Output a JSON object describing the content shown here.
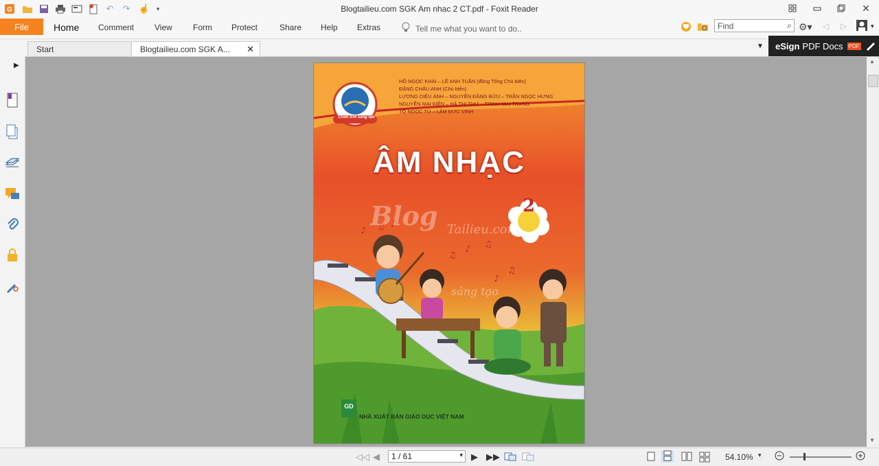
{
  "window": {
    "title": "Blogtailieu.com SGK Am nhac 2 CT.pdf - Foxit Reader"
  },
  "menu": {
    "file": "File",
    "items": [
      "Home",
      "Comment",
      "View",
      "Form",
      "Protect",
      "Share",
      "Help",
      "Extras"
    ],
    "tell_me": "Tell me what you want to do..",
    "find_placeholder": "Find"
  },
  "tabs": [
    {
      "label": "Start"
    },
    {
      "label": "Blogtailieu.com SGK A..."
    }
  ],
  "esign": {
    "bold": "eSign",
    "text": "PDF Docs",
    "badge": "PDF"
  },
  "status": {
    "page": "1 / 61",
    "zoom": "54.10%"
  },
  "cover": {
    "brand": "Chân trời sáng tạo",
    "authors": [
      "HỒ NGỌC KHẢI – LÊ ANH TUẤN (đồng Tổng Chủ biên)",
      "ĐẶNG CHÂU ANH (Chủ biên)",
      "LƯƠNG DIỆU ÁNH – NGUYỄN ĐĂNG BỬU – TRẦN NGỌC HƯNG",
      "NGUYỄN MAI KIÊN – HÀ THỊ THƯ – TRỊNH MAI TRANG",
      "TÔ NGỌC TÚ – LÂM ĐỨC VINH"
    ],
    "title": "ÂM NHẠC",
    "grade": "2",
    "watermark_1": "Blog",
    "watermark_2": "Tailieu.com",
    "watermark_3": "sáng tạo",
    "publisher_logo": "GD",
    "publisher": "NHÀ XUẤT BẢN GIÁO DỤC VIỆT NAM"
  },
  "colors": {
    "accent": "#f5821f",
    "esign_bg": "#222222"
  }
}
